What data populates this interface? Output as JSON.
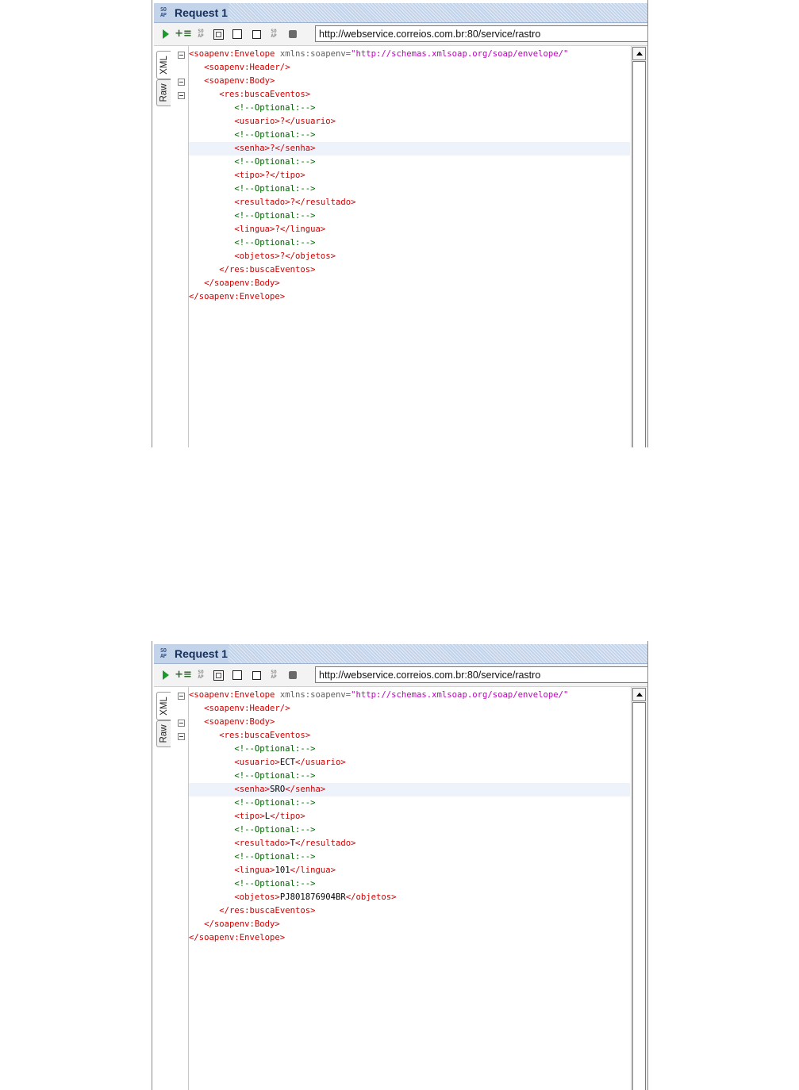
{
  "panels": [
    {
      "title": "Request 1",
      "endpoint_url": "http://webservice.correios.com.br:80/service/rastro",
      "editor_tabs": [
        "XML",
        "Raw"
      ],
      "usuario": "?",
      "senha": "?",
      "tipo": "?",
      "resultado": "?",
      "lingua": "?",
      "objetos": "?"
    },
    {
      "title": "Request 1",
      "endpoint_url": "http://webservice.correios.com.br:80/service/rastro",
      "editor_tabs": [
        "XML",
        "Raw"
      ],
      "usuario": "ECT",
      "senha": "SRO",
      "tipo": "L",
      "resultado": "T",
      "lingua": "101",
      "objetos": "PJ801876904BR"
    }
  ],
  "xml": {
    "envelope_open": "<soapenv:Envelope",
    "xmlns_attr": "xmlns:soapenv=",
    "xmlns_value": "\"http://schemas.xmlsoap.org/soap/envelope/\"",
    "envelope_close": "</soapenv:Envelope>",
    "header": "<soapenv:Header/>",
    "body_open": "<soapenv:Body>",
    "body_close": "</soapenv:Body>",
    "busca_open": "<res:buscaEventos>",
    "busca_close": "</res:buscaEventos>",
    "optional_comment": "<!--Optional:-->",
    "usuario_open": "<usuario>",
    "usuario_close": "</usuario>",
    "senha_open": "<senha>",
    "senha_close": "</senha>",
    "tipo_open": "<tipo>",
    "tipo_close": "</tipo>",
    "resultado_open": "<resultado>",
    "resultado_close": "</resultado>",
    "lingua_open": "<lingua>",
    "lingua_close": "</lingua>",
    "objetos_open": "<objetos>",
    "objetos_close": "</objetos>"
  },
  "icons": {
    "run": "play-icon",
    "add_step": "add-step-icon",
    "soap": "soap-icon",
    "frame": "frame-icon",
    "square": "square-icon",
    "copy": "copy-icon",
    "stop": "stop-icon"
  },
  "colors": {
    "tag": "#d00000",
    "attribute_value": "#c000c0",
    "comment": "#006400",
    "title_bar": "#c3d3ea",
    "highlight_line": "#eef3fb"
  }
}
